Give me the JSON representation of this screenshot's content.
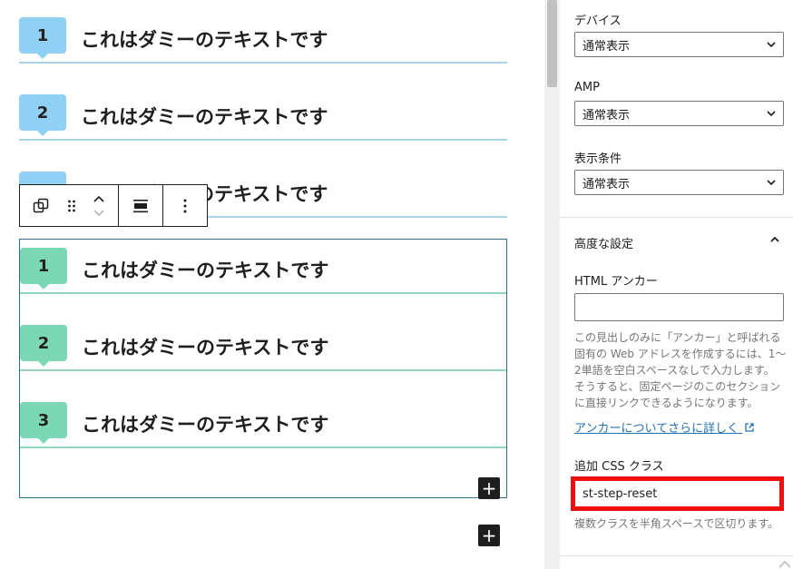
{
  "editor": {
    "steps_top": [
      {
        "number": "1",
        "text": "これはダミーのテキストです"
      },
      {
        "number": "2",
        "text": "これはダミーのテキストです"
      },
      {
        "number": "",
        "text": "これはダミーのテキストです"
      }
    ],
    "steps_group": [
      {
        "number": "1",
        "text": "これはダミーのテキストです"
      },
      {
        "number": "2",
        "text": "これはダミーのテキストです"
      },
      {
        "number": "3",
        "text": "これはダミーのテキストです"
      }
    ],
    "add_block_symbol": "+",
    "colors": {
      "blue_badge": "#90d0f4",
      "green_badge": "#7cd8b4",
      "group_border": "#2f6f8c"
    }
  },
  "sidebar": {
    "device": {
      "label": "デバイス",
      "value": "通常表示"
    },
    "amp": {
      "label": "AMP",
      "value": "通常表示"
    },
    "condition": {
      "label": "表示条件",
      "value": "通常表示"
    },
    "advanced": {
      "title": "高度な設定",
      "html_anchor_label": "HTML アンカー",
      "html_anchor_value": "",
      "help_lines": [
        "この見出しのみに「アンカー」と呼ばれる",
        "固有の Web アドレスを作成するには、1〜",
        "2単語を空白スペースなしで入力します。",
        "そうすると、固定ページのこのセクション",
        "に直接リンクできるようになります。"
      ],
      "link_text": "アンカーについてさらに詳しく",
      "css_label": "追加 CSS クラス",
      "css_value": "st-step-reset",
      "css_help": "複数クラスを半角スペースで区切ります。"
    },
    "colors": {
      "highlight": "#ee1010",
      "link": "#2271b1"
    }
  }
}
